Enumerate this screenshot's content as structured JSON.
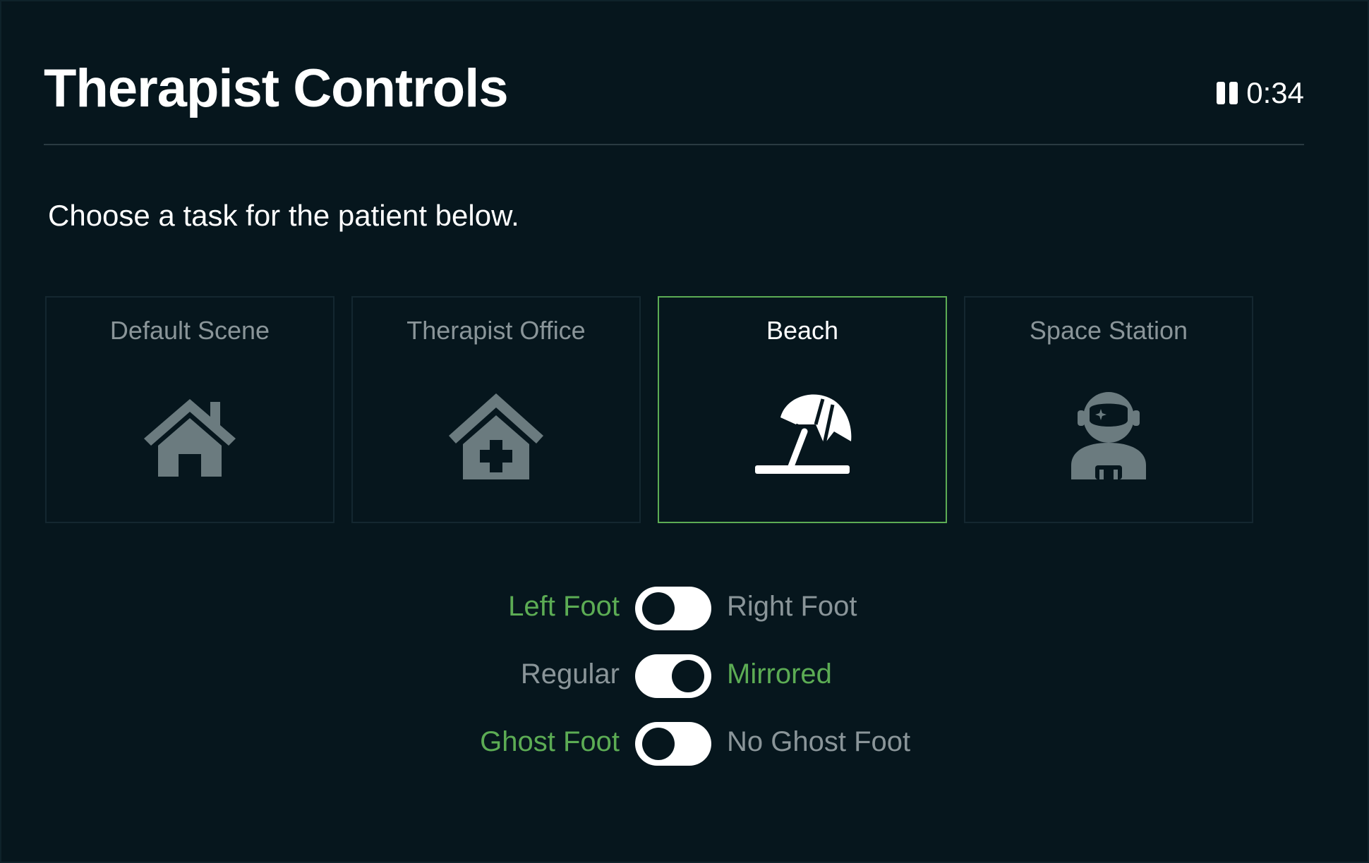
{
  "header": {
    "title": "Therapist Controls",
    "timer": "0:34",
    "timer_icon": "pause-icon"
  },
  "subtitle": "Choose a task for the patient below.",
  "scenes": [
    {
      "label": "Default Scene",
      "icon": "house-icon",
      "selected": false
    },
    {
      "label": "Therapist Office",
      "icon": "medical-house-icon",
      "selected": false
    },
    {
      "label": "Beach",
      "icon": "beach-umbrella-icon",
      "selected": true
    },
    {
      "label": "Space Station",
      "icon": "astronaut-icon",
      "selected": false
    }
  ],
  "toggles": [
    {
      "left_label": "Left Foot",
      "right_label": "Right Foot",
      "state": "left"
    },
    {
      "left_label": "Regular",
      "right_label": "Mirrored",
      "state": "right"
    },
    {
      "left_label": "Ghost Foot",
      "right_label": "No Ghost Foot",
      "state": "left"
    }
  ],
  "colors": {
    "background": "#06161d",
    "accent_green": "#5cac54",
    "muted_text": "#8a9599",
    "icon_gray": "#6b7b7f",
    "selected_border": "#5cac54"
  }
}
